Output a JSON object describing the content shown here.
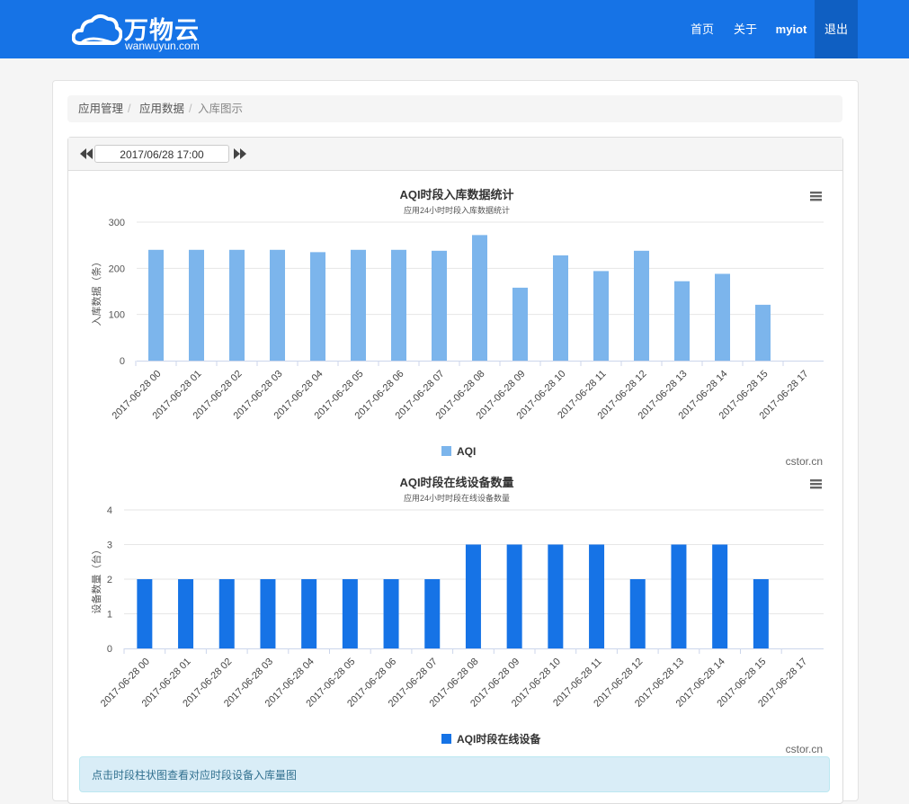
{
  "brand": {
    "name_cn": "万物云",
    "name_en": "wanwuyun.com"
  },
  "nav": {
    "items": [
      {
        "label": "首页"
      },
      {
        "label": "关于"
      },
      {
        "label": "myiot"
      },
      {
        "label": "退出"
      }
    ]
  },
  "breadcrumb": {
    "items": [
      "应用管理",
      "应用数据",
      "入库图示"
    ],
    "separator": "/"
  },
  "toolbar": {
    "date_value": "2017/06/28 17:00"
  },
  "colors": {
    "nav": "#1673e6",
    "bar1": "#7cb5ec",
    "bar2": "#1673e6",
    "info_bg": "#d9edf7"
  },
  "chart_data": [
    {
      "type": "bar",
      "title": "AQI时段入库数据统计",
      "subtitle": "应用24小时时段入库数据统计",
      "ylabel": "入库数据（条）",
      "ylim": [
        0,
        300
      ],
      "yticks": [
        0,
        100,
        200,
        300
      ],
      "categories": [
        "2017-06-28 00",
        "2017-06-28 01",
        "2017-06-28 02",
        "2017-06-28 03",
        "2017-06-28 04",
        "2017-06-28 05",
        "2017-06-28 06",
        "2017-06-28 07",
        "2017-06-28 08",
        "2017-06-28 09",
        "2017-06-28 10",
        "2017-06-28 11",
        "2017-06-28 12",
        "2017-06-28 13",
        "2017-06-28 14",
        "2017-06-28 15",
        "2017-06-28 17"
      ],
      "series": [
        {
          "name": "AQI",
          "values": [
            240,
            240,
            240,
            240,
            235,
            240,
            240,
            238,
            272,
            158,
            228,
            194,
            238,
            172,
            188,
            121,
            null
          ]
        }
      ],
      "legend": "bottom-center",
      "credits": "cstor.cn",
      "grid": true
    },
    {
      "type": "bar",
      "title": "AQI时段在线设备数量",
      "subtitle": "应用24小时时段在线设备数量",
      "ylabel": "设备数量（台）",
      "ylim": [
        0,
        4
      ],
      "yticks": [
        0,
        1,
        2,
        3,
        4
      ],
      "categories": [
        "2017-06-28 00",
        "2017-06-28 01",
        "2017-06-28 02",
        "2017-06-28 03",
        "2017-06-28 04",
        "2017-06-28 05",
        "2017-06-28 06",
        "2017-06-28 07",
        "2017-06-28 08",
        "2017-06-28 09",
        "2017-06-28 10",
        "2017-06-28 11",
        "2017-06-28 12",
        "2017-06-28 13",
        "2017-06-28 14",
        "2017-06-28 15",
        "2017-06-28 17"
      ],
      "series": [
        {
          "name": "AQI时段在线设备",
          "values": [
            2,
            2,
            2,
            2,
            2,
            2,
            2,
            2,
            3,
            3,
            3,
            3,
            2,
            3,
            3,
            2,
            null
          ]
        }
      ],
      "legend": "bottom-center",
      "credits": "cstor.cn",
      "grid": true
    }
  ],
  "info": {
    "text": "点击时段柱状图查看对应时段设备入库量图"
  }
}
